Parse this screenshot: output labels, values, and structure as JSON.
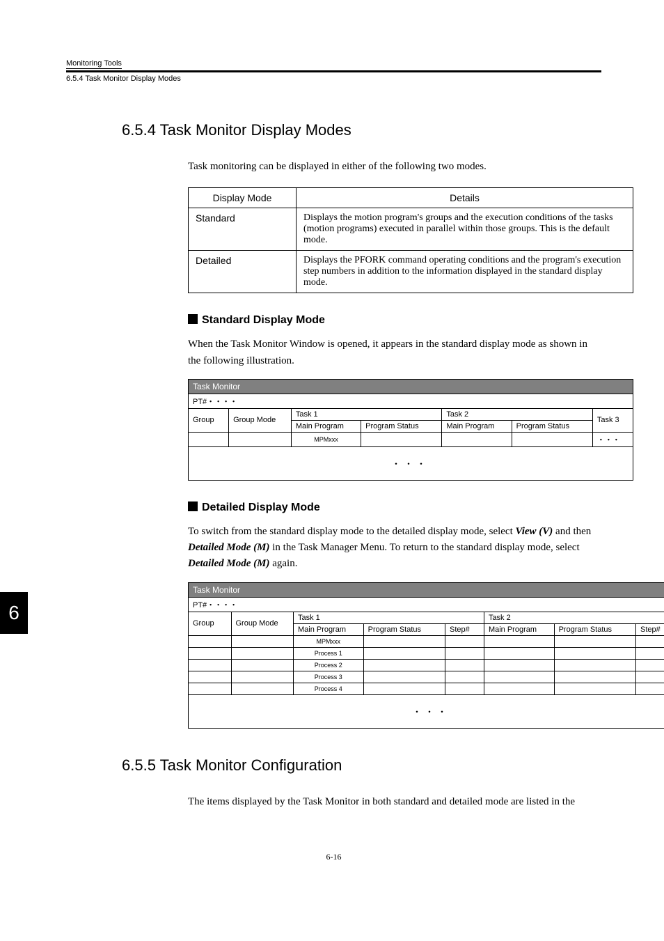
{
  "header": {
    "running_title": "Monitoring Tools",
    "sub_label": "6.5.4  Task Monitor Display Modes"
  },
  "section1": {
    "heading": "6.5.4  Task Monitor Display Modes",
    "intro": "Task monitoring can be displayed in either of the following two modes."
  },
  "dm_table": {
    "head_mode": "Display Mode",
    "head_details": "Details",
    "rows": [
      {
        "mode": "Standard",
        "details": "Displays the motion program's groups and the execution conditions of the tasks (motion programs) executed in parallel within those groups. This is the default mode."
      },
      {
        "mode": "Detailed",
        "details": "Displays the PFORK command operating conditions and the program's execution step numbers in addition to the information displayed in the standard display mode."
      }
    ]
  },
  "std_sub": {
    "title": "Standard Display Mode",
    "para": "When the Task Monitor Window is opened, it appears in the standard display mode as shown in the following illustration."
  },
  "std_tbl": {
    "titlebar": "Task Monitor",
    "pt": "PT#・・・・",
    "group": "Group",
    "group_mode": "Group Mode",
    "task1": "Task 1",
    "task2": "Task 2",
    "task3": "Task 3",
    "main_program": "Main Program",
    "program_status": "Program Status",
    "mpm": "MPMxxx",
    "dots": "・・・",
    "task3_dots": "・・・"
  },
  "det_sub": {
    "title": "Detailed Display Mode",
    "para_pre": "To switch from the standard display mode to the detailed display mode, select ",
    "view": "View (V)",
    "para_mid1": " and then ",
    "detailed_mode": "Detailed Mode (M)",
    "para_mid2": " in the Task Manager Menu. To return to the standard display mode, select ",
    "para_end": " again."
  },
  "det_tbl": {
    "titlebar": "Task Monitor",
    "pt": "PT#・・・・",
    "group": "Group",
    "group_mode": "Group Mode",
    "task1": "Task 1",
    "task2": "Task 2",
    "main_program": "Main Program",
    "program_status": "Program Status",
    "step": "Step#",
    "mpm": "MPMxxx",
    "p1": "Process 1",
    "p2": "Process 2",
    "p3": "Process 3",
    "p4": "Process 4",
    "dots": "・・・"
  },
  "section2": {
    "heading": "6.5.5  Task Monitor Configuration",
    "para": "The items displayed by the Task Monitor in both standard and detailed mode are listed in the"
  },
  "chapter_tab": "6",
  "page_number": "6-16"
}
